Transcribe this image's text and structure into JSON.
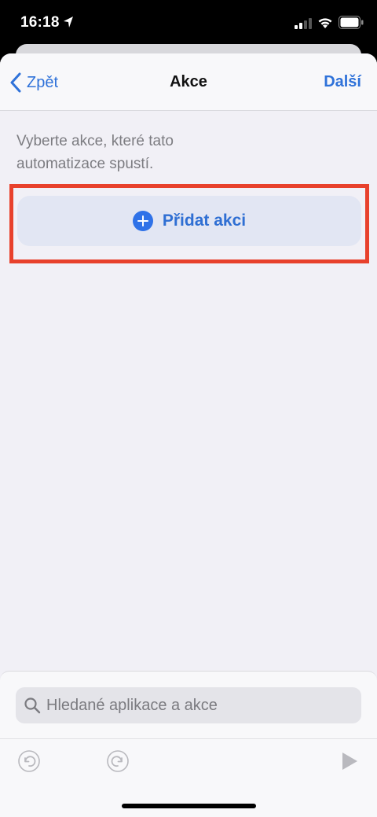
{
  "status_bar": {
    "time": "16:18"
  },
  "nav": {
    "back_label": "Zpět",
    "title": "Akce",
    "next_label": "Další"
  },
  "instruction": "Vyberte akce, které tato automatizace spustí.",
  "add_action": {
    "label": "Přidat akci",
    "icon": "plus-circle-icon"
  },
  "search": {
    "placeholder": "Hledané aplikace a akce",
    "icon": "magnifying-glass-icon"
  },
  "toolbar": {
    "undo_icon": "undo-icon",
    "redo_icon": "redo-icon",
    "play_icon": "play-icon"
  },
  "colors": {
    "accent": "#2f72d9",
    "highlight_border": "#e8412c",
    "background": "#f1f0f6"
  }
}
